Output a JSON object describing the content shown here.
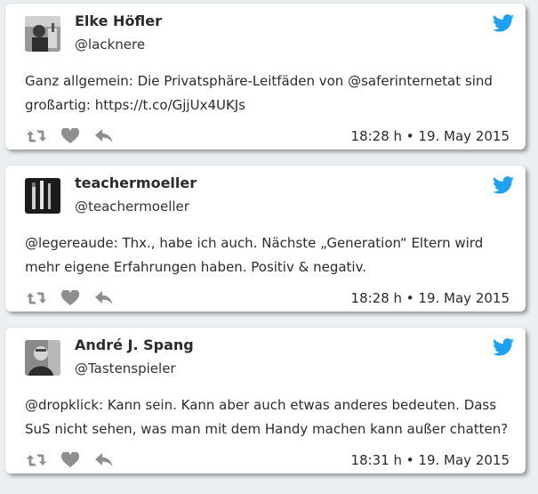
{
  "tweets": [
    {
      "name": "Elke Höfler",
      "handle": "@lacknere",
      "text": "Ganz allgemein: Die Privatsphäre-Leitfäden von @saferinternetat sind großartig: https://t.co/GjjUx4UKJs",
      "timestamp": "18:28 h • 19. May 2015",
      "avatar_icon": "avatar-photo-icon"
    },
    {
      "name": "teachermoeller",
      "handle": "@teachermoeller",
      "text": "@legereaude: Thx., habe ich auch. Nächste „Generation“ Eltern wird mehr eigene Erfahrungen haben. Positiv & negativ.",
      "timestamp": "18:28 h • 19. May 2015",
      "avatar_icon": "avatar-pens-icon"
    },
    {
      "name": "André J. Spang",
      "handle": "@Tastenspieler",
      "text": "@dropklick: Kann sein. Kann aber auch etwas anderes bedeuten. Dass SuS nicht sehen, was man mit dem Handy machen kann außer chatten?",
      "timestamp": "18:31 h • 19. May 2015",
      "avatar_icon": "avatar-portrait-icon"
    }
  ],
  "colors": {
    "twitter_blue": "#1da1f2",
    "action_gray": "#8e8e8e",
    "card_bg": "#ffffff"
  },
  "action_icons": [
    "retweet-icon",
    "like-icon",
    "reply-icon"
  ]
}
